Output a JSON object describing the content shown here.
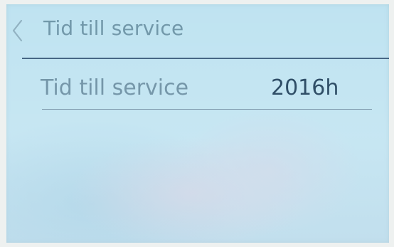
{
  "header": {
    "back_icon": "chevron-left-icon",
    "title": "Tid till service"
  },
  "rows": [
    {
      "label": "Tid till service",
      "value": "2016h"
    }
  ],
  "colors": {
    "screen_background": "#bfe3f1",
    "title_text": "#6f96a8",
    "value_text": "#1e3f5a",
    "divider": "#3d5f7f"
  }
}
